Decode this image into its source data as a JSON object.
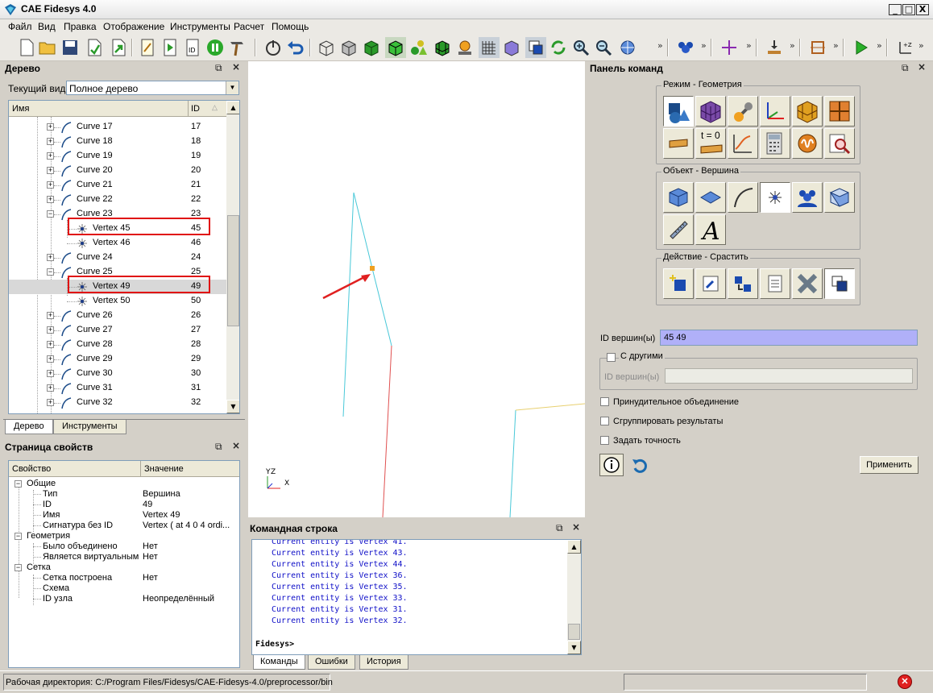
{
  "window": {
    "title": "CAE Fidesys 4.0",
    "min_glyph": "_",
    "max_glyph": "□",
    "close_glyph": "X"
  },
  "menu": [
    "Файл",
    "Вид",
    "Правка",
    "Отображение",
    "Инструменты",
    "Расчет",
    "Помощь"
  ],
  "tree_dock": {
    "title": "Дерево",
    "view_label": "Текущий вид",
    "view_value": "Полное дерево",
    "col_name": "Имя",
    "col_id": "ID",
    "rows": [
      {
        "name": "Curve 17",
        "id": "17"
      },
      {
        "name": "Curve 18",
        "id": "18"
      },
      {
        "name": "Curve 19",
        "id": "19"
      },
      {
        "name": "Curve 20",
        "id": "20"
      },
      {
        "name": "Curve 21",
        "id": "21"
      },
      {
        "name": "Curve 22",
        "id": "22"
      },
      {
        "name": "Curve 23",
        "id": "23"
      },
      {
        "name": "Vertex 45",
        "id": "45"
      },
      {
        "name": "Vertex 46",
        "id": "46"
      },
      {
        "name": "Curve 24",
        "id": "24"
      },
      {
        "name": "Curve 25",
        "id": "25"
      },
      {
        "name": "Vertex 49",
        "id": "49"
      },
      {
        "name": "Vertex 50",
        "id": "50"
      },
      {
        "name": "Curve 26",
        "id": "26"
      },
      {
        "name": "Curve 27",
        "id": "27"
      },
      {
        "name": "Curve 28",
        "id": "28"
      },
      {
        "name": "Curve 29",
        "id": "29"
      },
      {
        "name": "Curve 30",
        "id": "30"
      },
      {
        "name": "Curve 31",
        "id": "31"
      },
      {
        "name": "Curve 32",
        "id": "32"
      }
    ],
    "tabs": [
      "Дерево",
      "Инструменты"
    ]
  },
  "props_dock": {
    "title": "Страница свойств",
    "col_prop": "Свойство",
    "col_val": "Значение",
    "rows": [
      {
        "k": "Общие",
        "v": ""
      },
      {
        "k": "Тип",
        "v": "Вершина"
      },
      {
        "k": "ID",
        "v": "49"
      },
      {
        "k": "Имя",
        "v": "Vertex 49"
      },
      {
        "k": "Сигнатура без ID",
        "v": "Vertex ( at 4 0 4 ordi..."
      },
      {
        "k": "Геометрия",
        "v": ""
      },
      {
        "k": "Было объединено",
        "v": "Нет"
      },
      {
        "k": "Является виртуальным",
        "v": "Нет"
      },
      {
        "k": "Сетка",
        "v": ""
      },
      {
        "k": "Сетка построена",
        "v": "Нет"
      },
      {
        "k": "Схема",
        "v": ""
      },
      {
        "k": "ID узла",
        "v": "Неопределённый"
      }
    ]
  },
  "viewport": {
    "axis_z": "Z",
    "axis_y": "Y",
    "axis_x": "X"
  },
  "cmd_dock": {
    "title": "Командная строка",
    "lines": [
      "Current entity is Vertex 41.",
      "Current entity is Vertex 43.",
      "Current entity is Vertex 44.",
      "Current entity is Vertex 36.",
      "Current entity is Vertex 35.",
      "Current entity is Vertex 33.",
      "Current entity is Vertex 31.",
      "Current entity is Vertex 32."
    ],
    "prompt": "Fidesys>",
    "tabs": [
      "Команды",
      "Ошибки",
      "История"
    ]
  },
  "command_panel": {
    "title": "Панель команд",
    "mode_group": "Режим - Геометрия",
    "object_group": "Объект - Вершина",
    "action_group": "Действие - Срастить",
    "t0_label": "t = 0",
    "vertex_ids_label": "ID вершин(ы)",
    "vertex_ids_value": "45 49",
    "with_others_label": "С другими",
    "other_ids_label": "ID вершин(ы)",
    "other_ids_value": "",
    "force_merge_label": "Принудительное объединение",
    "group_results_label": "Сгруппировать результаты",
    "set_precision_label": "Задать точность",
    "apply_label": "Применить"
  },
  "status": {
    "workdir": "Рабочая директория: C:/Program Files/Fidesys/CAE-Fidesys-4.0/preprocessor/bin"
  },
  "colors": {
    "highlight": "#e01010",
    "vertex_marker": "#f0a020",
    "cyan_edge": "#48c8d8",
    "red_edge": "#e05050",
    "input_selected": "#b0b0f8"
  }
}
